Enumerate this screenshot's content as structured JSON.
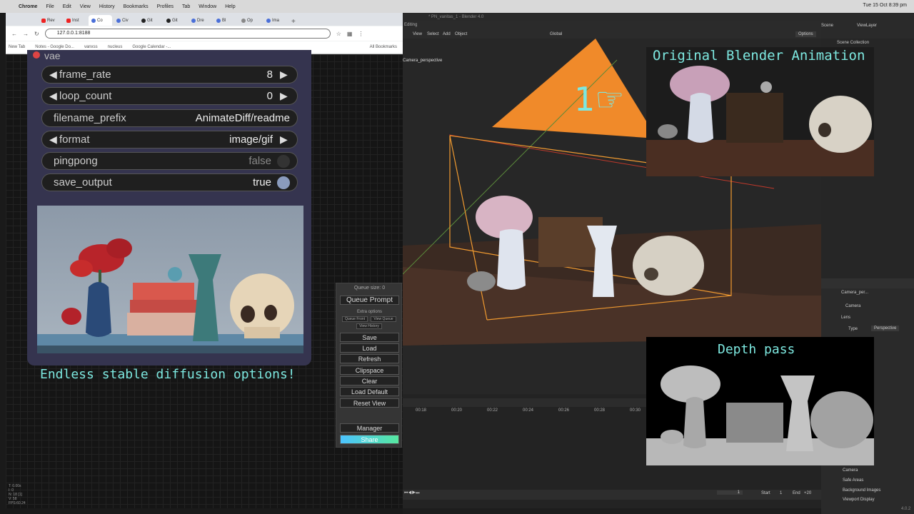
{
  "macbar": {
    "items": [
      "Chrome",
      "File",
      "Edit",
      "View",
      "History",
      "Bookmarks",
      "Profiles",
      "Tab",
      "Window",
      "Help"
    ],
    "clock": "Tue 15 Oct 8:39 pm"
  },
  "browser": {
    "tabs": [
      "Rev",
      "Inst",
      "Co",
      "Civ",
      "Git",
      "Git",
      "Dre",
      "Bl",
      "Op",
      "Ima"
    ],
    "url": "127.0.0.1:8188",
    "bookmarks": [
      "New Tab",
      "Notes - Google Do...",
      "vanxss",
      "nucleus",
      "Google Calendar -..."
    ],
    "all_bookmarks": "All Bookmarks"
  },
  "node": {
    "title": "vae",
    "widgets": [
      {
        "label": "frame_rate",
        "value": "8",
        "kind": "number"
      },
      {
        "label": "loop_count",
        "value": "0",
        "kind": "number"
      },
      {
        "label": "filename_prefix",
        "value": "AnimateDiff/readme",
        "kind": "text"
      },
      {
        "label": "format",
        "value": "image/gif",
        "kind": "combo"
      },
      {
        "label": "pingpong",
        "value": "false",
        "kind": "toggle"
      },
      {
        "label": "save_output",
        "value": "true",
        "kind": "toggle"
      }
    ]
  },
  "caption": "Endless stable diffusion options!",
  "queue": {
    "size_label": "Queue size: 0",
    "queue_prompt": "Queue Prompt",
    "extra_options": "Extra options",
    "queue_front": "Queue Front",
    "view_queue": "View Queue",
    "view_history": "View History",
    "buttons": [
      "Save",
      "Load",
      "Refresh",
      "Clipspace",
      "Clear",
      "Load Default",
      "Reset View"
    ],
    "manager": "Manager",
    "share": "Share"
  },
  "stats": [
    "T: 0.00s",
    "I: 0",
    "N: 18 [1]",
    "V: 58",
    "FPS:60.24"
  ],
  "blender": {
    "title": "* PN_vanitas_1 - Blender 4.0",
    "menus": [
      "View",
      "Select",
      "Add",
      "Object"
    ],
    "mode": "Editing",
    "orientation": "Global",
    "scene": "Scene",
    "viewlayer": "ViewLayer",
    "options": "Options",
    "collection": "Scene Collection",
    "camera_label": "Camera_perspective",
    "ticks": [
      "00:18",
      "00:20",
      "00:22",
      "00:24",
      "00:26",
      "00:28",
      "00:30"
    ],
    "frame": "1",
    "start_label": "Start",
    "start": "1",
    "end_label": "End",
    "end": "+20",
    "props": {
      "object": "Camera_per...",
      "data": "Camera",
      "lens": "Lens",
      "type_label": "Type",
      "type": "Perspective",
      "sections": [
        "Camera",
        "Safe Areas",
        "Background Images",
        "Viewport Display"
      ]
    },
    "version": "4.0.2"
  },
  "overlays": {
    "original": "Original Blender Animation",
    "depth": "Depth pass"
  }
}
